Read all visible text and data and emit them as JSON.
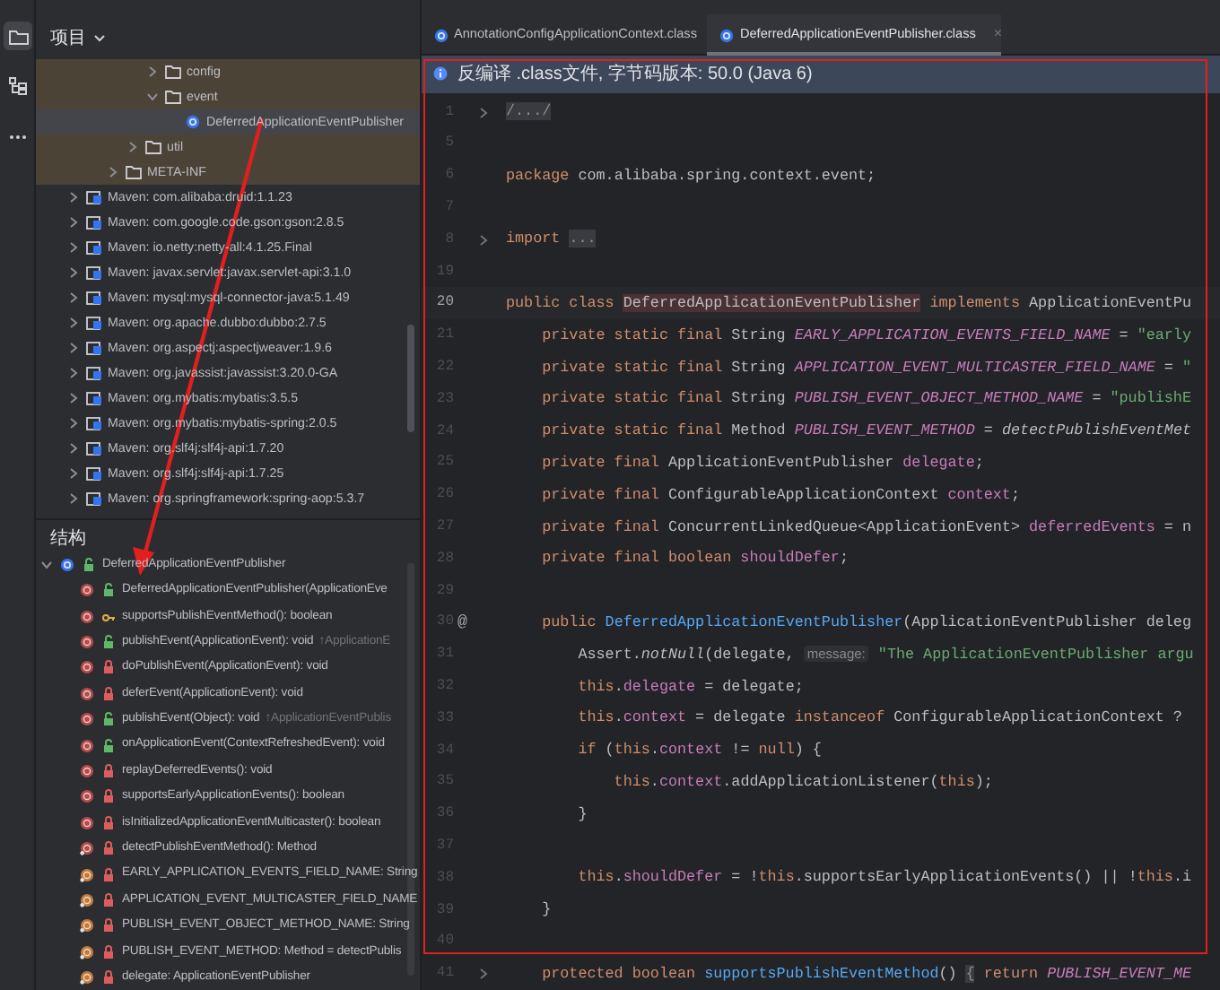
{
  "project_panel": {
    "title": "项目",
    "tree": [
      {
        "children": [
          {
            "children": [
              {
                "children": [
                  {
                    "children": [
                      {
                        "label": "config",
                        "kind": "folder",
                        "expanded": false,
                        "selected": false,
                        "highlighted": true
                      },
                      {
                        "label": "event",
                        "kind": "folder",
                        "expanded": true,
                        "selected": false,
                        "highlighted": true,
                        "children": [
                          {
                            "label": "DeferredApplicationEventPublisher",
                            "kind": "class",
                            "selected": true
                          }
                        ]
                      }
                    ]
                  },
                  {
                    "label": "util",
                    "kind": "folder",
                    "expanded": false,
                    "selected": false,
                    "highlighted": true
                  }
                ]
              },
              {
                "label": "META-INF",
                "kind": "folder",
                "expanded": false,
                "selected": false,
                "highlighted": true
              }
            ]
          }
        ]
      },
      {
        "label": "Maven: com.alibaba:druid:1.1.23",
        "kind": "library",
        "expanded": false,
        "selected": false,
        "highlighted": false
      },
      {
        "label": "Maven: com.google.code.gson:gson:2.8.5",
        "kind": "library",
        "expanded": false,
        "selected": false,
        "highlighted": false
      },
      {
        "label": "Maven: io.netty:netty-all:4.1.25.Final",
        "kind": "library",
        "expanded": false,
        "selected": false,
        "highlighted": false
      },
      {
        "label": "Maven: javax.servlet:javax.servlet-api:3.1.0",
        "kind": "library",
        "expanded": false,
        "selected": false,
        "highlighted": false
      },
      {
        "label": "Maven: mysql:mysql-connector-java:5.1.49",
        "kind": "library",
        "expanded": false,
        "selected": false,
        "highlighted": false
      },
      {
        "label": "Maven: org.apache.dubbo:dubbo:2.7.5",
        "kind": "library",
        "expanded": false,
        "selected": false,
        "highlighted": false
      },
      {
        "label": "Maven: org.aspectj:aspectjweaver:1.9.6",
        "kind": "library",
        "expanded": false,
        "selected": false,
        "highlighted": false
      },
      {
        "label": "Maven: org.javassist:javassist:3.20.0-GA",
        "kind": "library",
        "expanded": false,
        "selected": false,
        "highlighted": false
      },
      {
        "label": "Maven: org.mybatis:mybatis:3.5.5",
        "kind": "library",
        "expanded": false,
        "selected": false,
        "highlighted": false
      },
      {
        "label": "Maven: org.mybatis:mybatis-spring:2.0.5",
        "kind": "library",
        "expanded": false,
        "selected": false,
        "highlighted": false
      },
      {
        "label": "Maven: org.slf4j:slf4j-api:1.7.20",
        "kind": "library",
        "expanded": false,
        "selected": false,
        "highlighted": false
      },
      {
        "label": "Maven: org.slf4j:slf4j-api:1.7.25",
        "kind": "library",
        "expanded": false,
        "selected": false,
        "highlighted": false
      },
      {
        "label": "Maven: org.springframework:spring-aop:5.3.7",
        "kind": "library",
        "expanded": false,
        "selected": false,
        "highlighted": false
      }
    ]
  },
  "structure_panel": {
    "title": "结构",
    "root": {
      "label": "DeferredApplicationEventPublisher",
      "kind": "public-class",
      "expanded": true,
      "children": [
        {
          "label": "DeferredApplicationEventPublisher(ApplicationEve",
          "kind": "public-method"
        },
        {
          "label": "supportsPublishEventMethod(): boolean",
          "kind": "protected-method"
        },
        {
          "label": "publishEvent(ApplicationEvent): void",
          "hint": "↑ApplicationE",
          "kind": "public-method"
        },
        {
          "label": "doPublishEvent(ApplicationEvent): void",
          "kind": "private-method"
        },
        {
          "label": "deferEvent(ApplicationEvent): void",
          "kind": "private-method"
        },
        {
          "label": "publishEvent(Object): void",
          "hint": "↑ApplicationEventPublis",
          "kind": "public-method"
        },
        {
          "label": "onApplicationEvent(ContextRefreshedEvent): void",
          "kind": "public-method"
        },
        {
          "label": "replayDeferredEvents(): void",
          "kind": "private-method"
        },
        {
          "label": "supportsEarlyApplicationEvents(): boolean",
          "kind": "private-method"
        },
        {
          "label": "isInitializedApplicationEventMulticaster(): boolean",
          "kind": "private-method"
        },
        {
          "label": "detectPublishEventMethod(): Method",
          "kind": "private-static-method"
        },
        {
          "label": "EARLY_APPLICATION_EVENTS_FIELD_NAME: String",
          "kind": "private-field"
        },
        {
          "label": "APPLICATION_EVENT_MULTICASTER_FIELD_NAME",
          "kind": "private-field"
        },
        {
          "label": "PUBLISH_EVENT_OBJECT_METHOD_NAME: String",
          "kind": "private-field"
        },
        {
          "label": "PUBLISH_EVENT_METHOD: Method = detectPublis",
          "kind": "private-field"
        },
        {
          "label": "delegate: ApplicationEventPublisher",
          "kind": "private-field"
        }
      ]
    }
  },
  "editor": {
    "tabs": [
      {
        "label": "AnnotationConfigApplicationContext.class",
        "selected": false,
        "closable": false
      },
      {
        "label": "DeferredApplicationEventPublisher.class",
        "selected": true,
        "closable": true,
        "close": "×"
      }
    ],
    "banner": "反编译 .class文件, 字节码版本: 50.0 (Java 6)",
    "lines": [
      {
        "number": "1",
        "fold": true,
        "current": false,
        "segments": [
          {
            "kind": "folded",
            "text": "/.../"
          }
        ]
      },
      {
        "number": "5",
        "fold": false,
        "current": false
      },
      {
        "number": "6",
        "fold": false,
        "current": false,
        "segments": [
          {
            "kind": "keyword",
            "text": "package"
          },
          {
            "kind": "plain",
            "text": " com.alibaba.spring.context.event;"
          }
        ]
      },
      {
        "number": "7",
        "fold": false,
        "current": false
      },
      {
        "number": "8",
        "fold": true,
        "current": false,
        "segments": [
          {
            "kind": "keyword",
            "text": "import "
          },
          {
            "kind": "folded",
            "text": "..."
          }
        ]
      },
      {
        "number": "19",
        "fold": false,
        "current": false
      },
      {
        "number": "20",
        "fold": false,
        "current": true,
        "segments": [
          {
            "kind": "keyword",
            "text": "public class "
          },
          {
            "kind": "usage",
            "text": "DeferredApplicationEventPublisher"
          },
          {
            "kind": "keyword",
            "text": " implements "
          },
          {
            "kind": "plain",
            "text": "ApplicationEventPu"
          }
        ]
      },
      {
        "number": "21",
        "fold": false,
        "current": false,
        "segments": [
          {
            "kind": "keyword",
            "text": "    private static final "
          },
          {
            "kind": "plain",
            "text": "String "
          },
          {
            "kind": "constant",
            "text": "EARLY_APPLICATION_EVENTS_FIELD_NAME"
          },
          {
            "kind": "plain",
            "text": " = "
          },
          {
            "kind": "string",
            "text": "\"early"
          }
        ]
      },
      {
        "number": "22",
        "fold": false,
        "current": false,
        "segments": [
          {
            "kind": "keyword",
            "text": "    private static final "
          },
          {
            "kind": "plain",
            "text": "String "
          },
          {
            "kind": "constant",
            "text": "APPLICATION_EVENT_MULTICASTER_FIELD_NAME"
          },
          {
            "kind": "plain",
            "text": " = "
          },
          {
            "kind": "string",
            "text": "\""
          }
        ]
      },
      {
        "number": "23",
        "fold": false,
        "current": false,
        "segments": [
          {
            "kind": "keyword",
            "text": "    private static final "
          },
          {
            "kind": "plain",
            "text": "String "
          },
          {
            "kind": "constant",
            "text": "PUBLISH_EVENT_OBJECT_METHOD_NAME"
          },
          {
            "kind": "plain",
            "text": " = "
          },
          {
            "kind": "string",
            "text": "\"publishE"
          }
        ]
      },
      {
        "number": "24",
        "fold": false,
        "current": false,
        "segments": [
          {
            "kind": "keyword",
            "text": "    private static final "
          },
          {
            "kind": "plain",
            "text": "Method "
          },
          {
            "kind": "constant",
            "text": "PUBLISH_EVENT_METHOD"
          },
          {
            "kind": "plain",
            "text": " = "
          },
          {
            "kind": "call",
            "text": "detectPublishEventMet"
          }
        ]
      },
      {
        "number": "25",
        "fold": false,
        "current": false,
        "segments": [
          {
            "kind": "keyword",
            "text": "    private final "
          },
          {
            "kind": "plain",
            "text": "ApplicationEventPublisher "
          },
          {
            "kind": "field",
            "text": "delegate"
          },
          {
            "kind": "plain",
            "text": ";"
          }
        ]
      },
      {
        "number": "26",
        "fold": false,
        "current": false,
        "segments": [
          {
            "kind": "keyword",
            "text": "    private final "
          },
          {
            "kind": "plain",
            "text": "ConfigurableApplicationContext "
          },
          {
            "kind": "field",
            "text": "context"
          },
          {
            "kind": "plain",
            "text": ";"
          }
        ]
      },
      {
        "number": "27",
        "fold": false,
        "current": false,
        "segments": [
          {
            "kind": "keyword",
            "text": "    private final "
          },
          {
            "kind": "plain",
            "text": "ConcurrentLinkedQueue<ApplicationEvent> "
          },
          {
            "kind": "field",
            "text": "deferredEvents"
          },
          {
            "kind": "plain",
            "text": " = n"
          }
        ]
      },
      {
        "number": "28",
        "fold": false,
        "current": false,
        "segments": [
          {
            "kind": "keyword",
            "text": "    private final boolean "
          },
          {
            "kind": "field",
            "text": "shouldDefer"
          },
          {
            "kind": "plain",
            "text": ";"
          }
        ]
      },
      {
        "number": "29",
        "fold": false,
        "current": false
      },
      {
        "number": "30",
        "fold": false,
        "current": false,
        "gutter_mark": "@",
        "segments": [
          {
            "kind": "keyword",
            "text": "    public "
          },
          {
            "kind": "declaration",
            "text": "DeferredApplicationEventPublisher"
          },
          {
            "kind": "plain",
            "text": "(ApplicationEventPublisher deleg"
          }
        ]
      },
      {
        "number": "31",
        "fold": false,
        "current": false,
        "segments": [
          {
            "kind": "plain",
            "text": "        Assert."
          },
          {
            "kind": "call",
            "text": "notNull"
          },
          {
            "kind": "plain",
            "text": "(delegate, "
          },
          {
            "kind": "hint",
            "text": "message:"
          },
          {
            "kind": "string",
            "text": " \"The ApplicationEventPublisher argu"
          }
        ]
      },
      {
        "number": "32",
        "fold": false,
        "current": false,
        "segments": [
          {
            "kind": "keyword",
            "text": "        this"
          },
          {
            "kind": "plain",
            "text": "."
          },
          {
            "kind": "field",
            "text": "delegate"
          },
          {
            "kind": "plain",
            "text": " = delegate;"
          }
        ]
      },
      {
        "number": "33",
        "fold": false,
        "current": false,
        "segments": [
          {
            "kind": "keyword",
            "text": "        this"
          },
          {
            "kind": "plain",
            "text": "."
          },
          {
            "kind": "field",
            "text": "context"
          },
          {
            "kind": "plain",
            "text": " = delegate "
          },
          {
            "kind": "keyword",
            "text": "instanceof"
          },
          {
            "kind": "plain",
            "text": " ConfigurableApplicationContext ?"
          }
        ]
      },
      {
        "number": "34",
        "fold": false,
        "current": false,
        "segments": [
          {
            "kind": "keyword",
            "text": "        if"
          },
          {
            "kind": "plain",
            "text": " ("
          },
          {
            "kind": "keyword",
            "text": "this"
          },
          {
            "kind": "plain",
            "text": "."
          },
          {
            "kind": "field",
            "text": "context"
          },
          {
            "kind": "plain",
            "text": " != "
          },
          {
            "kind": "keyword",
            "text": "null"
          },
          {
            "kind": "plain",
            "text": ") {"
          }
        ]
      },
      {
        "number": "35",
        "fold": false,
        "current": false,
        "segments": [
          {
            "kind": "keyword",
            "text": "            this"
          },
          {
            "kind": "plain",
            "text": "."
          },
          {
            "kind": "field",
            "text": "context"
          },
          {
            "kind": "plain",
            "text": ".addApplicationListener("
          },
          {
            "kind": "keyword",
            "text": "this"
          },
          {
            "kind": "plain",
            "text": ");"
          }
        ]
      },
      {
        "number": "36",
        "fold": false,
        "current": false,
        "segments": [
          {
            "kind": "plain",
            "text": "        }"
          }
        ]
      },
      {
        "number": "37",
        "fold": false,
        "current": false
      },
      {
        "number": "38",
        "fold": false,
        "current": false,
        "segments": [
          {
            "kind": "keyword",
            "text": "        this"
          },
          {
            "kind": "plain",
            "text": "."
          },
          {
            "kind": "field",
            "text": "shouldDefer"
          },
          {
            "kind": "plain",
            "text": " = !"
          },
          {
            "kind": "keyword",
            "text": "this"
          },
          {
            "kind": "plain",
            "text": ".supportsEarlyApplicationEvents() || !"
          },
          {
            "kind": "keyword",
            "text": "this"
          },
          {
            "kind": "plain",
            "text": ".i"
          }
        ]
      },
      {
        "number": "39",
        "fold": false,
        "current": false,
        "segments": [
          {
            "kind": "plain",
            "text": "    }"
          }
        ]
      },
      {
        "number": "40",
        "fold": false,
        "current": false
      },
      {
        "number": "41",
        "fold": true,
        "current": false,
        "segments": [
          {
            "kind": "keyword",
            "text": "    protected boolean "
          },
          {
            "kind": "declaration",
            "text": "supportsPublishEventMethod"
          },
          {
            "kind": "plain",
            "text": "() "
          },
          {
            "kind": "folded",
            "text": "{"
          },
          {
            "kind": "keyword",
            "text": " return "
          },
          {
            "kind": "constant",
            "text": "PUBLISH_EVENT_ME"
          }
        ]
      }
    ]
  }
}
